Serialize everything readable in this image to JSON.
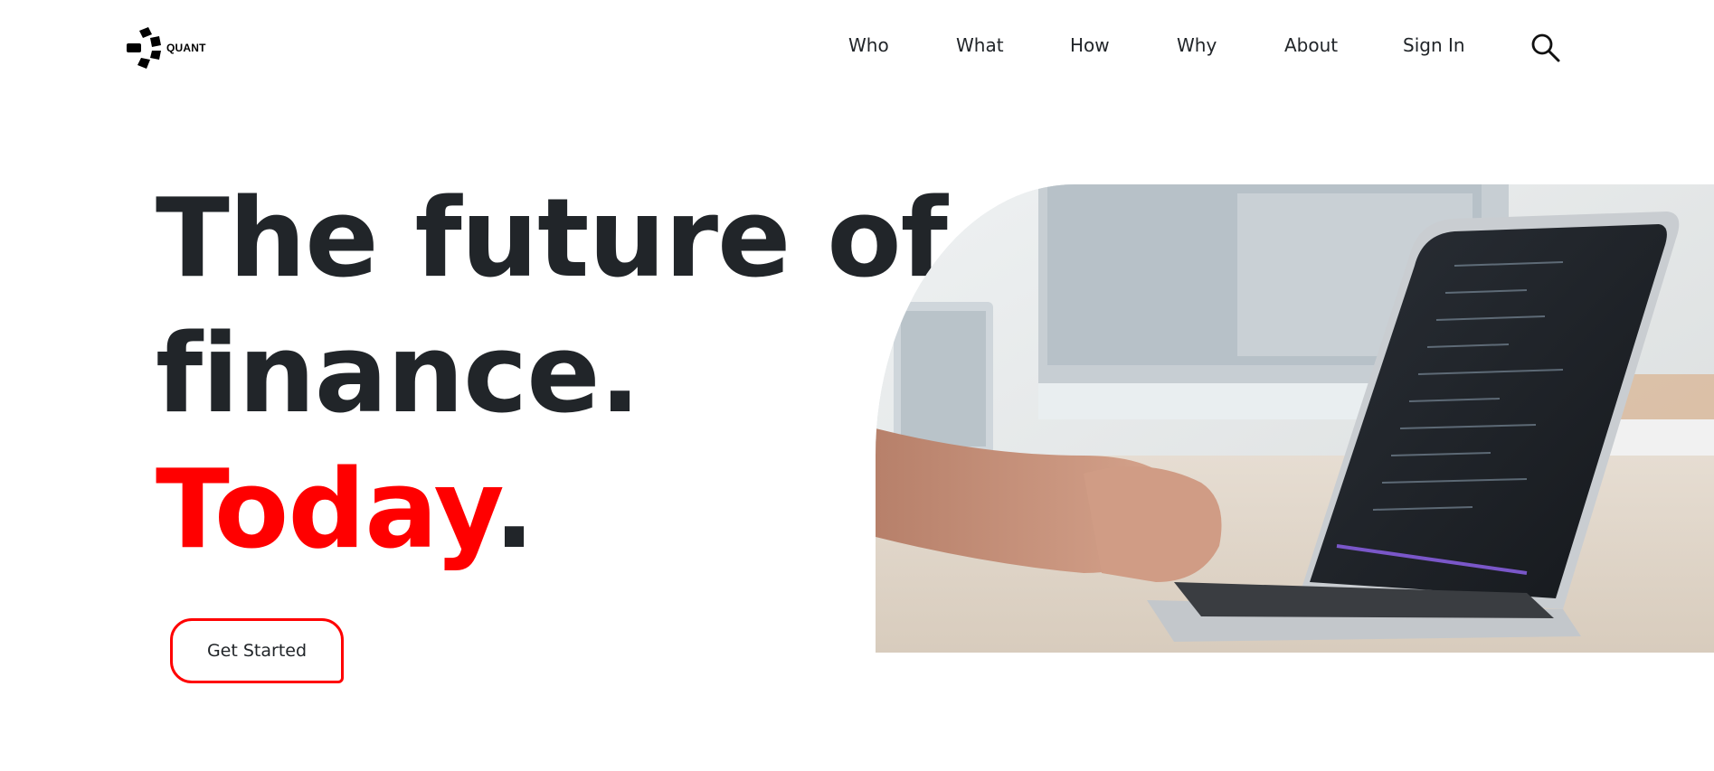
{
  "brand": {
    "name": "QUANT",
    "icon": "quant-logo-icon"
  },
  "nav": {
    "items": [
      {
        "label": "Who"
      },
      {
        "label": "What"
      },
      {
        "label": "How"
      },
      {
        "label": "Why"
      },
      {
        "label": "About"
      },
      {
        "label": "Sign In"
      }
    ],
    "search_icon": "search-icon"
  },
  "hero": {
    "line1": "The future of",
    "line2": "finance.",
    "line3_accent": "Today",
    "line3_end": ".",
    "cta_label": "Get Started",
    "image": "laptop-coding-photo"
  },
  "colors": {
    "accent": "#ff0000",
    "text": "#212529",
    "background": "#ffffff"
  }
}
